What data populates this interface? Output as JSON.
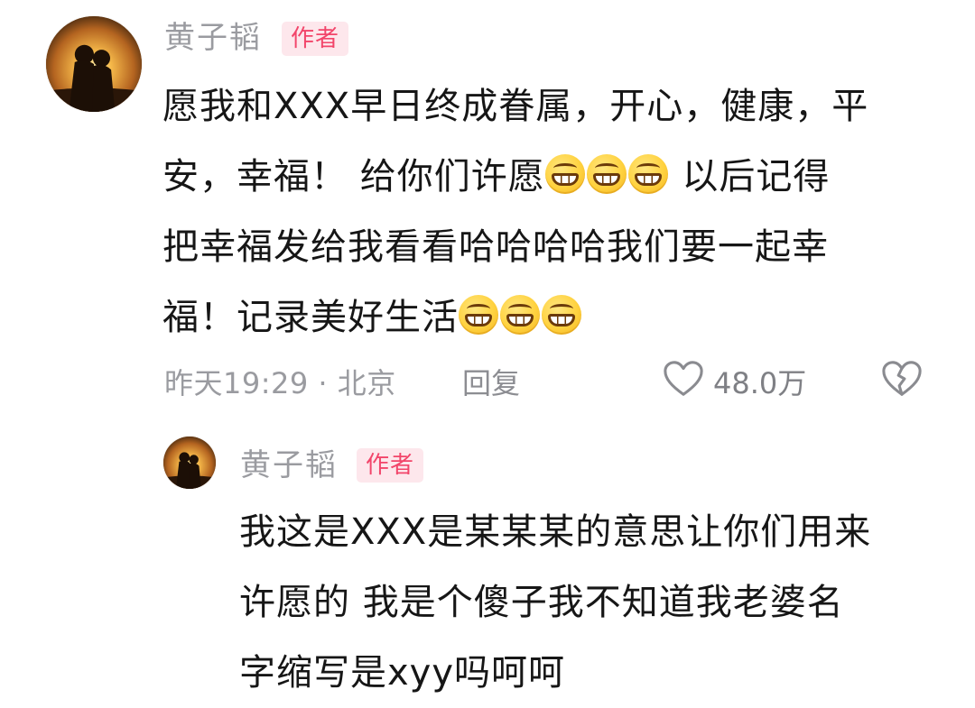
{
  "comment": {
    "username": "黄子韬",
    "badge": "作者",
    "text_line1": "愿我和XXX早日终成眷属，开心，健康，平",
    "text_line2_before": "安，幸福！ 给你们许愿",
    "text_line2_after": " 以后记得",
    "text_line3": "把幸福发给我看看哈哈哈哈我们要一起幸",
    "text_line4": "福！记录美好生活",
    "timestamp": "昨天19:29 · 北京",
    "reply_label": "回复",
    "like_count": "48.0万",
    "emoji_name": "grin-emoji"
  },
  "reply": {
    "username": "黄子韬",
    "badge": "作者",
    "text_line1": "我这是XXX是某某某的意思让你们用来",
    "text_line2": "许愿的 我是个傻子我不知道我老婆名",
    "text_line3": "字缩写是xyy吗呵呵"
  },
  "icons": {
    "like": "heart-outline-icon",
    "dislike": "broken-heart-icon"
  },
  "colors": {
    "badge_text": "#f2456a",
    "badge_bg": "#fde7ec",
    "meta_text": "#9a9ba0",
    "emoji_yellow": "#ffd23f"
  }
}
